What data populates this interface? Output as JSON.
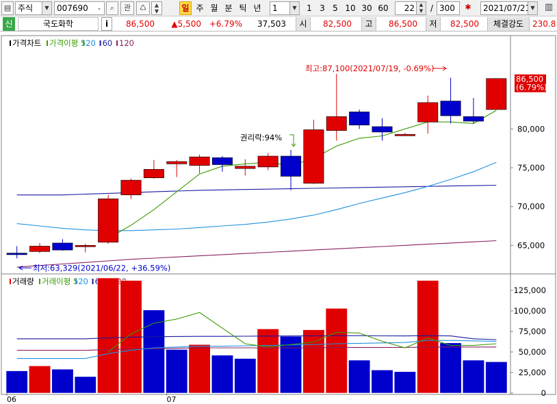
{
  "toolbar": {
    "market": "주식",
    "code": "007690",
    "btn_kwan": "관",
    "periods": [
      "일",
      "주",
      "월",
      "분",
      "틱",
      "년"
    ],
    "active_period": "일",
    "interval_value": "1",
    "quick_intervals": [
      "1",
      "3",
      "5",
      "10",
      "30",
      "60"
    ],
    "view_count": "22",
    "view_sep": "/",
    "total_count": "300",
    "date": "2021/07/21"
  },
  "quote": {
    "credit": "신",
    "name": "국도화학",
    "info_btn": "i",
    "price": "86,500",
    "change": "▲5,500",
    "change_pct": "+6.79%",
    "volume": "37,503",
    "open_label": "시",
    "open": "82,500",
    "high_label": "고",
    "high": "86,500",
    "low_label": "저",
    "low": "82,500",
    "strength_label": "체결강도",
    "strength": "230.8"
  },
  "colors": {
    "up": "#e00000",
    "down": "#0000cc",
    "ma5": "#3a9a00",
    "ma20": "#2090e0",
    "ma60": "#1a1aa0",
    "ma120": "#8a2060"
  },
  "chart_data": [
    {
      "type": "candlestick",
      "legend": [
        "가격차트",
        "가격이평 5",
        "20",
        "60",
        "120"
      ],
      "x_tick_labels": [
        {
          "label": "06",
          "index": 0
        },
        {
          "label": "07",
          "index": 7
        }
      ],
      "y_ticks": [
        65000,
        70000,
        75000,
        80000
      ],
      "ylim": [
        61500,
        91500
      ],
      "candles": [
        {
          "o": 64000,
          "h": 64900,
          "l": 63329,
          "c": 63800
        },
        {
          "o": 64200,
          "h": 65300,
          "l": 64000,
          "c": 64900
        },
        {
          "o": 65300,
          "h": 65800,
          "l": 64300,
          "c": 64400
        },
        {
          "o": 65000,
          "h": 65200,
          "l": 64100,
          "c": 65000
        },
        {
          "o": 65400,
          "h": 71500,
          "l": 65200,
          "c": 71000
        },
        {
          "o": 71500,
          "h": 73600,
          "l": 71000,
          "c": 73400
        },
        {
          "o": 73700,
          "h": 76000,
          "l": 73600,
          "c": 74800
        },
        {
          "o": 75500,
          "h": 76000,
          "l": 73800,
          "c": 75800
        },
        {
          "o": 75300,
          "h": 76700,
          "l": 74300,
          "c": 76400
        },
        {
          "o": 76300,
          "h": 76500,
          "l": 74500,
          "c": 75400
        },
        {
          "o": 74900,
          "h": 76100,
          "l": 74000,
          "c": 75200
        },
        {
          "o": 75100,
          "h": 76900,
          "l": 74700,
          "c": 76500
        },
        {
          "o": 76500,
          "h": 77300,
          "l": 72100,
          "c": 73900
        },
        {
          "o": 73000,
          "h": 81200,
          "l": 72900,
          "c": 79900
        },
        {
          "o": 79800,
          "h": 87100,
          "l": 78500,
          "c": 81600
        },
        {
          "o": 82200,
          "h": 82500,
          "l": 80000,
          "c": 80500
        },
        {
          "o": 80300,
          "h": 81400,
          "l": 78500,
          "c": 79600
        },
        {
          "o": 79300,
          "h": 79500,
          "l": 79100,
          "c": 79300
        },
        {
          "o": 80900,
          "h": 84300,
          "l": 79400,
          "c": 83400
        },
        {
          "o": 83600,
          "h": 86600,
          "l": 80700,
          "c": 81700
        },
        {
          "o": 81600,
          "h": 84000,
          "l": 80700,
          "c": 81000
        },
        {
          "o": 82500,
          "h": 86500,
          "l": 82500,
          "c": 86500
        }
      ],
      "ma5": [
        null,
        null,
        null,
        null,
        65900,
        67600,
        69600,
        71900,
        74200,
        75200,
        75500,
        75700,
        75300,
        76200,
        77800,
        78800,
        79100,
        80000,
        80900,
        80900,
        80700,
        82400
      ],
      "ma20": [
        67800,
        67500,
        67200,
        67000,
        66900,
        66900,
        67000,
        67100,
        67300,
        67500,
        67700,
        68000,
        68400,
        68900,
        69600,
        70400,
        71100,
        71800,
        72600,
        73500,
        74500,
        75700
      ],
      "ma60": [
        71500,
        71500,
        71500,
        71600,
        71700,
        71800,
        71900,
        72000,
        72100,
        72150,
        72200,
        72250,
        72300,
        72350,
        72400,
        72450,
        72500,
        72550,
        72600,
        72650,
        72700,
        72750
      ],
      "ma120": [
        62200,
        62400,
        62600,
        62800,
        63000,
        63200,
        63350,
        63500,
        63650,
        63800,
        63950,
        64100,
        64250,
        64400,
        64550,
        64700,
        64850,
        65000,
        65150,
        65300,
        65450,
        65600
      ],
      "annotations": {
        "high": "최고:87,100(2021/07/19, -0.69%)",
        "low": "최저:63,329(2021/06/22, +36.59%)",
        "rights": "권리락:94%"
      },
      "last_price_label": "86,500",
      "last_pct_label": "(6.79%)"
    },
    {
      "type": "bar",
      "legend": [
        "거래량",
        "거래이평 5",
        "20",
        "60",
        "120"
      ],
      "y_ticks": [
        0,
        25000,
        50000,
        75000,
        100000,
        125000
      ],
      "y_tick_labels": [
        "0",
        "25,000",
        "50,000",
        "75,000",
        "100,000",
        "125,000"
      ],
      "ylim": [
        0,
        140000
      ],
      "values": [
        27000,
        33000,
        29000,
        20000,
        140000,
        137000,
        101000,
        53000,
        59000,
        46000,
        42000,
        78000,
        69000,
        77000,
        103000,
        40000,
        28000,
        26000,
        137000,
        61000,
        40000,
        38000
      ],
      "up": [
        false,
        true,
        false,
        false,
        true,
        true,
        false,
        false,
        true,
        false,
        false,
        true,
        false,
        true,
        true,
        false,
        false,
        false,
        true,
        false,
        false,
        false
      ],
      "ma5": [
        null,
        null,
        null,
        null,
        50000,
        72000,
        85000,
        90000,
        98000,
        79000,
        60000,
        56000,
        59000,
        62000,
        74000,
        73000,
        63000,
        55000,
        67000,
        58000,
        58000,
        60000
      ],
      "ma20": [
        42000,
        42000,
        42000,
        42000,
        48000,
        52000,
        55000,
        56000,
        57000,
        57000,
        57500,
        58000,
        58500,
        59000,
        60000,
        60500,
        61000,
        61500,
        64000,
        64000,
        63500,
        63000
      ],
      "ma60": [
        66000,
        66000,
        66000,
        66000,
        67000,
        68000,
        68500,
        68800,
        69000,
        69000,
        69200,
        69300,
        69500,
        69600,
        69800,
        69800,
        69600,
        69500,
        69800,
        69500,
        66000,
        65000
      ],
      "ma120": [
        52000,
        52000,
        52000,
        52000,
        53000,
        53500,
        54000,
        54500,
        55000,
        55000,
        55000,
        55000,
        55000,
        55000,
        55500,
        55500,
        55500,
        55500,
        56000,
        56000,
        56000,
        56000
      ]
    }
  ]
}
